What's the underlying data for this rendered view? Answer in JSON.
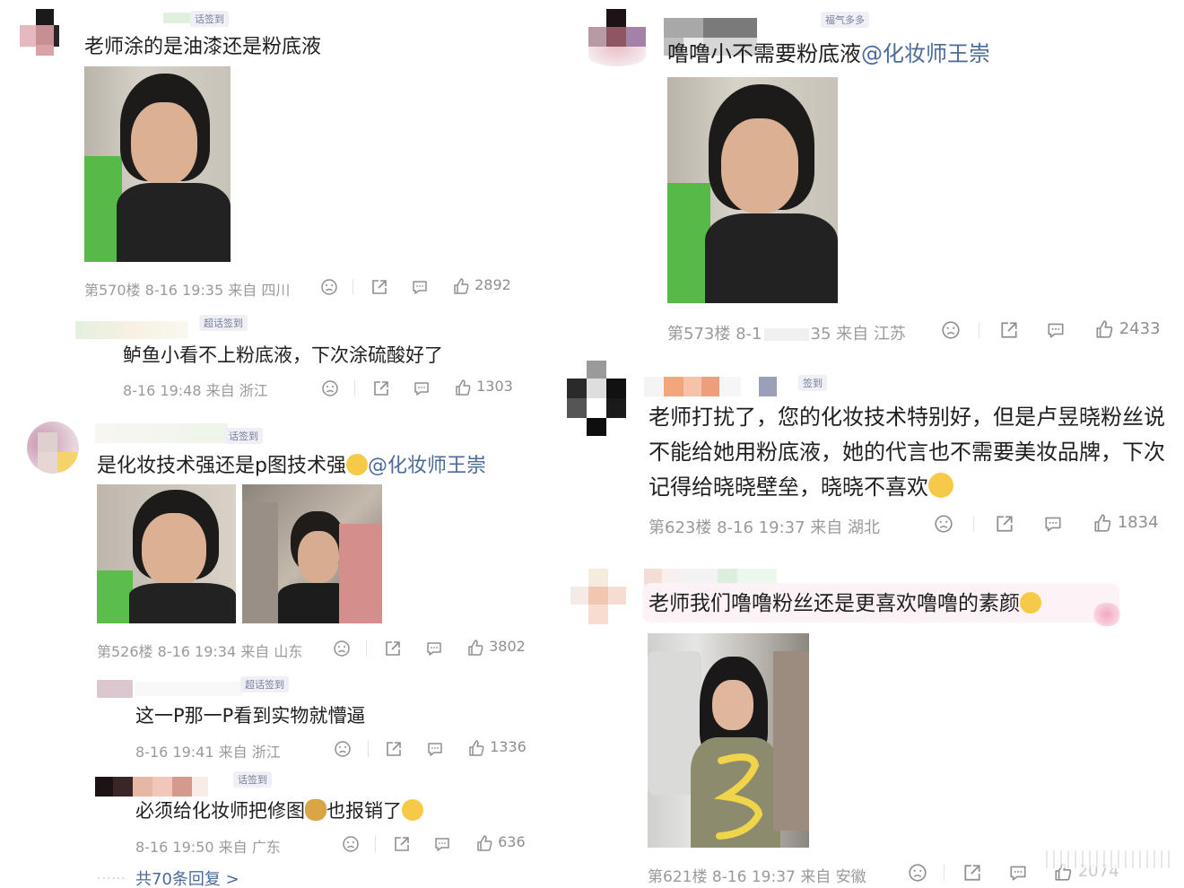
{
  "left": {
    "c570": {
      "badge": "话签到",
      "text": "老师涂的是油漆还是粉底液",
      "floor": "第570楼",
      "time": "8-16 19:35",
      "location": "来自 四川",
      "likes": "2892",
      "reply": {
        "badge": "超话签到",
        "text": "鲈鱼小看不上粉底液，下次涂硫酸好了",
        "time": "8-16 19:48",
        "location": "来自 浙江",
        "likes": "1303"
      }
    },
    "c526": {
      "badge": "话签到",
      "text": "是化妆技术强还是p图技术强",
      "mention": "@化妆师王崇",
      "floor": "第526楼",
      "time": "8-16 19:34",
      "location": "来自 山东",
      "likes": "3802",
      "replies": [
        {
          "badge": "超话签到",
          "text": "这一P那一P看到实物就懵逼",
          "time": "8-16 19:41",
          "location": "来自 浙江",
          "likes": "1336"
        },
        {
          "badge": "话签到",
          "text": "必须给化妆师把修图",
          "text_after": "也报销了",
          "time": "8-16 19:50",
          "location": "来自 广东",
          "likes": "636"
        }
      ],
      "more": "共70条回复 >"
    }
  },
  "right": {
    "c573": {
      "badge": "福气多多",
      "text": "噜噜小不需要粉底液",
      "mention": "@化妆师王崇",
      "floor": "第573楼",
      "time_a": "8-1",
      "time_b": "35",
      "location": "来自 江苏",
      "likes": "2433"
    },
    "c623": {
      "badge": "签到",
      "text": "老师打扰了，您的化妆技术特别好，但是卢昱晓粉丝说不能给她用粉底液，她的代言也不需要美妆品牌，下次记得给晓晓壁垒，晓晓不喜欢",
      "floor": "第623楼",
      "time": "8-16 19:37",
      "location": "来自 湖北",
      "likes": "1834"
    },
    "c621": {
      "text": "老师我们噜噜粉丝还是更喜欢噜噜的素颜",
      "floor": "第621楼",
      "time": "8-16 19:37",
      "location": "来自 安徽",
      "likes": "2074"
    }
  },
  "icons": [
    "dislike-icon",
    "share-icon",
    "comment-icon",
    "like-icon"
  ],
  "colors": {
    "mention": "#4a6a98",
    "meta": "#9a9a9a",
    "badge_bg": "#eef0f6"
  }
}
